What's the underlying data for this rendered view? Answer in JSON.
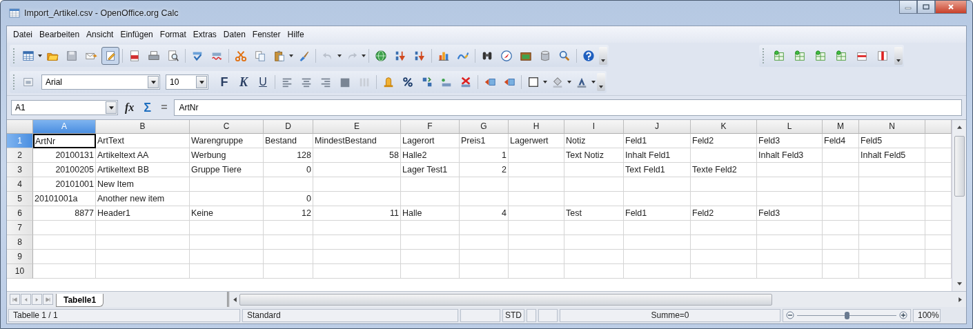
{
  "window": {
    "title": "Import_Artikel.csv - OpenOffice.org Calc"
  },
  "menu": [
    "Datei",
    "Bearbeiten",
    "Ansicht",
    "Einfügen",
    "Format",
    "Extras",
    "Daten",
    "Fenster",
    "Hilfe"
  ],
  "standard_toolbar": {
    "edit_file_on": true,
    "undo_disabled": true,
    "redo_disabled": true
  },
  "formatting_toolbar": {
    "font_name": "Arial",
    "font_size": "10",
    "bold_label": "F",
    "italic_label": "K",
    "underline_label": "U"
  },
  "formula_bar": {
    "name_box": "A1",
    "function_label": "fx",
    "sum_label": "Σ",
    "equals_label": "=",
    "formula": "ArtNr"
  },
  "sheet": {
    "columns": [
      {
        "label": "A",
        "selected": true
      },
      {
        "label": "B",
        "selected": false
      },
      {
        "label": "C",
        "selected": false
      },
      {
        "label": "D",
        "selected": false
      },
      {
        "label": "E",
        "selected": false
      },
      {
        "label": "F",
        "selected": false
      },
      {
        "label": "G",
        "selected": false
      },
      {
        "label": "H",
        "selected": false
      },
      {
        "label": "I",
        "selected": false
      },
      {
        "label": "J",
        "selected": false
      },
      {
        "label": "K",
        "selected": false
      },
      {
        "label": "L",
        "selected": false
      },
      {
        "label": "M",
        "selected": false
      },
      {
        "label": "N",
        "selected": false
      }
    ],
    "rows": [
      {
        "label": "1",
        "selected": true,
        "cells": [
          {
            "text": "ArtNr",
            "kind": "text"
          },
          {
            "text": "ArtText",
            "kind": "text"
          },
          {
            "text": "Warengruppe",
            "kind": "text"
          },
          {
            "text": "Bestand",
            "kind": "text"
          },
          {
            "text": "MindestBestand",
            "kind": "text"
          },
          {
            "text": "Lagerort",
            "kind": "text"
          },
          {
            "text": "Preis1",
            "kind": "text"
          },
          {
            "text": "Lagerwert",
            "kind": "text"
          },
          {
            "text": "Notiz",
            "kind": "text"
          },
          {
            "text": "Feld1",
            "kind": "text"
          },
          {
            "text": "Feld2",
            "kind": "text"
          },
          {
            "text": "Feld3",
            "kind": "text"
          },
          {
            "text": "Feld4",
            "kind": "text"
          },
          {
            "text": "Feld5",
            "kind": "text"
          }
        ]
      },
      {
        "label": "2",
        "selected": false,
        "cells": [
          {
            "text": "20100131",
            "kind": "number"
          },
          {
            "text": "Artikeltext AA",
            "kind": "text"
          },
          {
            "text": "Werbung",
            "kind": "text"
          },
          {
            "text": "128",
            "kind": "number"
          },
          {
            "text": "58",
            "kind": "number"
          },
          {
            "text": "Halle2",
            "kind": "text"
          },
          {
            "text": "1",
            "kind": "number"
          },
          null,
          {
            "text": "Text Notiz",
            "kind": "text"
          },
          {
            "text": "Inhalt Feld1",
            "kind": "text"
          },
          null,
          {
            "text": "Inhalt Feld3",
            "kind": "text"
          },
          null,
          {
            "text": "Inhalt Feld5",
            "kind": "text"
          }
        ]
      },
      {
        "label": "3",
        "selected": false,
        "cells": [
          {
            "text": "20100205",
            "kind": "number"
          },
          {
            "text": "Artikeltext BB",
            "kind": "text"
          },
          {
            "text": "Gruppe Tiere",
            "kind": "text"
          },
          {
            "text": "0",
            "kind": "number"
          },
          null,
          {
            "text": "Lager Test1",
            "kind": "text"
          },
          {
            "text": "2",
            "kind": "number"
          },
          null,
          null,
          {
            "text": "Text Feld1",
            "kind": "text"
          },
          {
            "text": "Texte Feld2",
            "kind": "text"
          }
        ]
      },
      {
        "label": "4",
        "selected": false,
        "cells": [
          {
            "text": "20101001",
            "kind": "number"
          },
          {
            "text": "New Item",
            "kind": "text"
          }
        ]
      },
      {
        "label": "5",
        "selected": false,
        "cells": [
          {
            "text": "20101001a",
            "kind": "text"
          },
          {
            "text": "Another new item",
            "kind": "text"
          },
          null,
          {
            "text": "0",
            "kind": "number"
          }
        ]
      },
      {
        "label": "6",
        "selected": false,
        "cells": [
          {
            "text": "8877",
            "kind": "number"
          },
          {
            "text": "Header1",
            "kind": "text"
          },
          {
            "text": "Keine",
            "kind": "text"
          },
          {
            "text": "12",
            "kind": "number"
          },
          {
            "text": "11",
            "kind": "number"
          },
          {
            "text": "Halle",
            "kind": "text"
          },
          {
            "text": "4",
            "kind": "number"
          },
          null,
          {
            "text": "Test",
            "kind": "text"
          },
          {
            "text": "Feld1",
            "kind": "text"
          },
          {
            "text": "Feld2",
            "kind": "text"
          },
          {
            "text": "Feld3",
            "kind": "text"
          }
        ]
      },
      {
        "label": "7",
        "selected": false
      },
      {
        "label": "8",
        "selected": false
      },
      {
        "label": "9",
        "selected": false
      },
      {
        "label": "10",
        "selected": false
      }
    ]
  },
  "sheet_tabs": [
    {
      "label": "Tabelle1",
      "selected": true
    }
  ],
  "status_bar": {
    "sheet": "Tabelle 1 / 1",
    "page_style": "Standard",
    "selection_mode": "STD",
    "sum": "Summe=0",
    "zoom": {
      "level": 0.5
    },
    "zoom_percent": "100%"
  }
}
